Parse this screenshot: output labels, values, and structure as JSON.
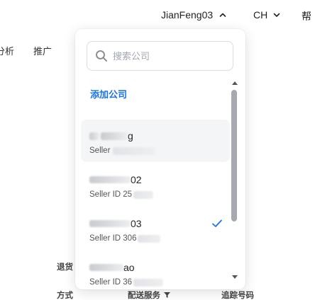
{
  "topbar": {
    "account_name": "JianFeng03",
    "language": "CH",
    "help_label": "帮"
  },
  "nav": {
    "items": [
      "分析",
      "推广"
    ]
  },
  "background_table": {
    "row_label": "退货",
    "headers": [
      "方式",
      "配送服务",
      "追踪号码"
    ]
  },
  "dropdown": {
    "search_placeholder": "搜索公司",
    "add_company_label": "添加公司",
    "accounts": [
      {
        "name_suffix": "g",
        "seller_prefix": "Seller",
        "selected": false,
        "hovered": true
      },
      {
        "name_suffix": "02",
        "seller_prefix": "Seller ID 25",
        "selected": false,
        "hovered": false
      },
      {
        "name_suffix": "03",
        "seller_prefix": "Seller ID 306",
        "selected": true,
        "hovered": false
      },
      {
        "name_suffix": "ao",
        "seller_prefix": "Seller ID 36",
        "selected": false,
        "hovered": false
      }
    ]
  },
  "colors": {
    "accent": "#1a73e8",
    "checkmark": "#1a73e8"
  }
}
